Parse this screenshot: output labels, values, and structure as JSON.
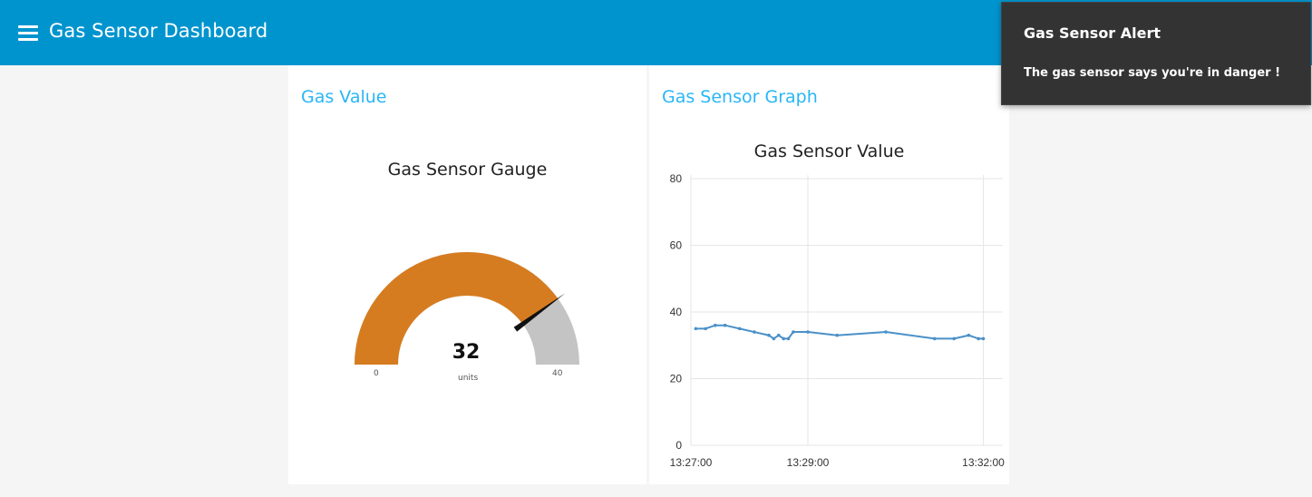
{
  "header": {
    "title": "Gas Sensor Dashboard",
    "menu_icon": "hamburger-menu-icon",
    "color": "#0094ce"
  },
  "gauge_card": {
    "title": "Gas Value",
    "gauge_title": "Gas Sensor Gauge",
    "value": "32",
    "units": "units",
    "min": "0",
    "max": "40",
    "fill_color": "#d67c20",
    "track_color": "#c4c4c4"
  },
  "graph_card": {
    "title": "Gas Sensor Graph"
  },
  "notification": {
    "title": "Gas Sensor Alert",
    "message": "The gas sensor says you're in danger !"
  },
  "chart_data": {
    "type": "line",
    "title": "Gas Sensor Value",
    "x_ticks": [
      "13:27:00",
      "13:29:00",
      "13:32:00"
    ],
    "y_ticks": [
      0,
      20,
      40,
      60,
      80
    ],
    "ylim": [
      0,
      80
    ],
    "xlim": [
      "13:27:00",
      "13:32:20"
    ],
    "grid": true,
    "series": [
      {
        "color": "#4a90c8",
        "points": [
          {
            "x": "13:27:05",
            "y": 35
          },
          {
            "x": "13:27:15",
            "y": 35
          },
          {
            "x": "13:27:25",
            "y": 36
          },
          {
            "x": "13:27:35",
            "y": 36
          },
          {
            "x": "13:27:50",
            "y": 35
          },
          {
            "x": "13:28:05",
            "y": 34
          },
          {
            "x": "13:28:20",
            "y": 33
          },
          {
            "x": "13:28:25",
            "y": 32
          },
          {
            "x": "13:28:30",
            "y": 33
          },
          {
            "x": "13:28:35",
            "y": 32
          },
          {
            "x": "13:28:40",
            "y": 32
          },
          {
            "x": "13:28:45",
            "y": 34
          },
          {
            "x": "13:29:00",
            "y": 34
          },
          {
            "x": "13:29:30",
            "y": 33
          },
          {
            "x": "13:30:20",
            "y": 34
          },
          {
            "x": "13:31:10",
            "y": 32
          },
          {
            "x": "13:31:30",
            "y": 32
          },
          {
            "x": "13:31:45",
            "y": 33
          },
          {
            "x": "13:31:55",
            "y": 32
          },
          {
            "x": "13:32:00",
            "y": 32
          }
        ]
      }
    ]
  }
}
